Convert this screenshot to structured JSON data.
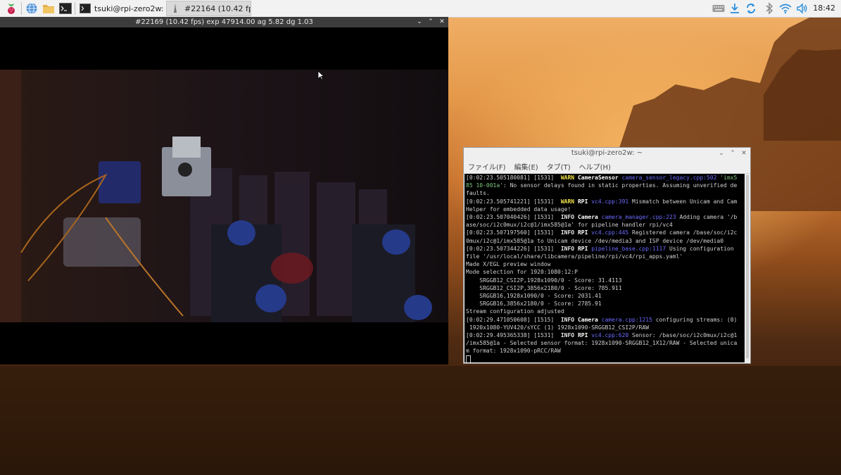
{
  "taskbar": {
    "tasks": [
      {
        "label": "tsuki@rpi-zero2w: ~",
        "icon": "terminal-icon"
      },
      {
        "label": "#22164 (10.42 fps)...",
        "icon": "camera-app-icon"
      }
    ],
    "tray_icons": [
      "keyboard-icon",
      "download-icon",
      "sync-icon",
      "bluetooth-icon",
      "wifi-icon",
      "volume-icon"
    ],
    "clock": "18:42",
    "launchers": [
      "raspberry-menu-icon",
      "browser-globe-icon",
      "file-manager-icon",
      "terminal-launcher-icon"
    ]
  },
  "camera_window": {
    "title": "#22169 (10.42 fps) exp 47914.00 ag 5.82 dg 1.03"
  },
  "terminal": {
    "title": "tsuki@rpi-zero2w: ~",
    "menu": [
      "ファイル(F)",
      "編集(E)",
      "タブ(T)",
      "ヘルプ(H)"
    ],
    "lines": [
      [
        {
          "t": "[0:02:23.505180081] [1531]  "
        },
        {
          "t": "WARN ",
          "c": "warn"
        },
        {
          "t": "CameraSensor ",
          "c": "tag"
        },
        {
          "t": "camera_sensor_legacy.cpp:502 ",
          "c": "src"
        },
        {
          "t": "'imx5",
          "c": "grn"
        }
      ],
      [
        {
          "t": "85 10-001a'",
          "c": "grn"
        },
        {
          "t": ": No sensor delays found in static properties. Assuming unverified de"
        }
      ],
      [
        {
          "t": "faults."
        }
      ],
      [
        {
          "t": "[0:02:23.505741221] [1531]  "
        },
        {
          "t": "WARN ",
          "c": "warn"
        },
        {
          "t": "RPI ",
          "c": "tag"
        },
        {
          "t": "vc4.cpp:391 ",
          "c": "src"
        },
        {
          "t": "Mismatch between Unicam and Cam"
        }
      ],
      [
        {
          "t": "Helper for embedded data usage!"
        }
      ],
      [
        {
          "t": "[0:02:23.507040426] [1531]  "
        },
        {
          "t": "INFO ",
          "c": "info"
        },
        {
          "t": "Camera ",
          "c": "tag"
        },
        {
          "t": "camera_manager.cpp:223 ",
          "c": "src"
        },
        {
          "t": "Adding camera '/b"
        }
      ],
      [
        {
          "t": "ase/soc/i2c0mux/i2c@1/imx585@1a' for pipeline handler rpi/vc4"
        }
      ],
      [
        {
          "t": "[0:02:23.507197560] [1531]  "
        },
        {
          "t": "INFO ",
          "c": "info"
        },
        {
          "t": "RPI ",
          "c": "tag"
        },
        {
          "t": "vc4.cpp:445 ",
          "c": "src"
        },
        {
          "t": "Registered camera /base/soc/i2c"
        }
      ],
      [
        {
          "t": "0mux/i2c@1/imx585@1a to Unicam device /dev/media3 and ISP device /dev/media0"
        }
      ],
      [
        {
          "t": "[0:02:23.507344226] [1531]  "
        },
        {
          "t": "INFO ",
          "c": "info"
        },
        {
          "t": "RPI ",
          "c": "tag"
        },
        {
          "t": "pipeline_base.cpp:1117 ",
          "c": "src"
        },
        {
          "t": "Using configuration"
        }
      ],
      [
        {
          "t": "file '/usr/local/share/libcamera/pipeline/rpi/vc4/rpi_apps.yaml'"
        }
      ],
      [
        {
          "t": "Made X/EGL preview window"
        }
      ],
      [
        {
          "t": "Mode selection for 1920:1080:12:P"
        }
      ],
      [
        {
          "t": "    SRGGB12_CSI2P,1928x1090/0 - Score: 31.4113"
        }
      ],
      [
        {
          "t": "    SRGGB12_CSI2P,3856x2180/0 - Score: 785.911"
        }
      ],
      [
        {
          "t": "    SRGGB16,1928x1090/0 - Score: 2031.41"
        }
      ],
      [
        {
          "t": "    SRGGB16,3856x2180/0 - Score: 2785.91"
        }
      ],
      [
        {
          "t": "Stream configuration adjusted"
        }
      ],
      [
        {
          "t": "[0:02:29.471050608] [1515]  "
        },
        {
          "t": "INFO ",
          "c": "info"
        },
        {
          "t": "Camera ",
          "c": "tag"
        },
        {
          "t": "camera.cpp:1215 ",
          "c": "src"
        },
        {
          "t": "configuring streams: (0)"
        }
      ],
      [
        {
          "t": " 1920x1080-YUV420/sYCC (1) 1928x1090-SRGGB12_CSI2P/RAW"
        }
      ],
      [
        {
          "t": "[0:02:29.495365338] [1531]  "
        },
        {
          "t": "INFO ",
          "c": "info"
        },
        {
          "t": "RPI ",
          "c": "tag"
        },
        {
          "t": "vc4.cpp:620 ",
          "c": "src"
        },
        {
          "t": "Sensor: /base/soc/i2c0mux/i2c@1"
        }
      ],
      [
        {
          "t": "/imx585@1a - Selected sensor format: 1928x1090-SRGGB12_1X12/RAW - Selected unica"
        }
      ],
      [
        {
          "t": "m format: 1928x1090-pRCC/RAW"
        }
      ]
    ]
  },
  "colors": {
    "taskbar_bg": "#f2f2f2",
    "terminal_bg": "#000000",
    "warn": "#f0e14a",
    "source_link": "#6b6bff",
    "sensor_name": "#7fc97f"
  }
}
